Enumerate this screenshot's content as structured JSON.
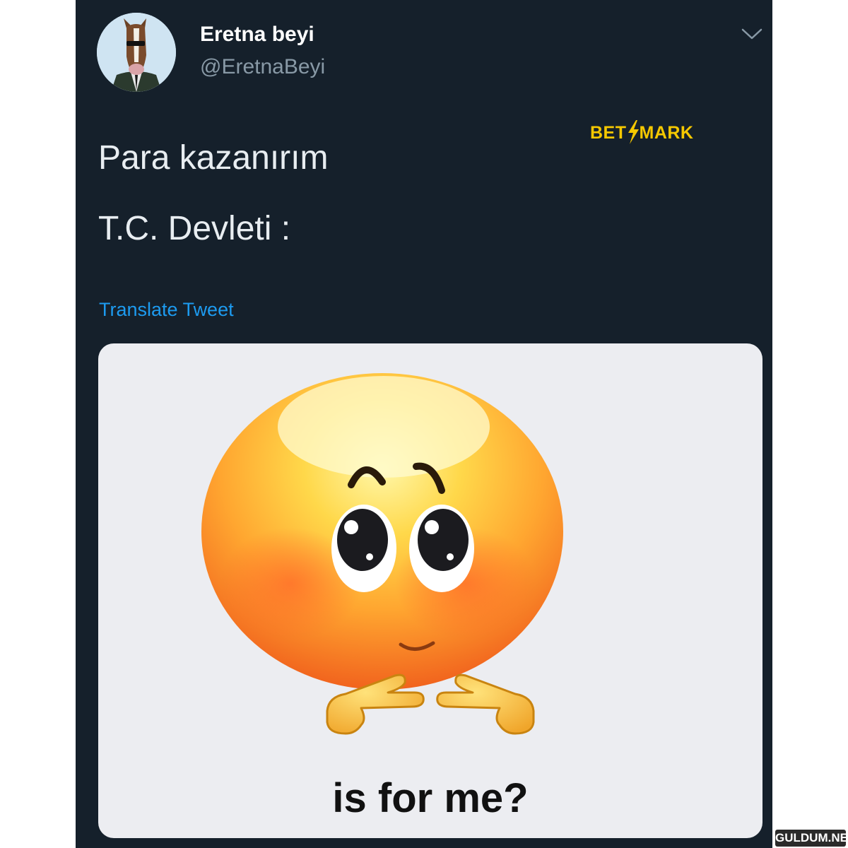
{
  "tweet": {
    "display_name": "Eretna beyi",
    "handle": "@EretnaBeyi",
    "lines": [
      "Para kazanırım",
      "T.C. Devleti :"
    ],
    "translate_label": "Translate Tweet",
    "menu_icon": "chevron-down-icon",
    "avatar_icon": "horse-character-avatar"
  },
  "overlay": {
    "brand_left": "BET",
    "brand_right": "MARK",
    "brand_color": "#f5c800"
  },
  "media": {
    "caption": "is for me?",
    "emoji": "shy-face-pointing-fingers"
  },
  "watermark": {
    "label": "GULDUM.NET"
  },
  "colors": {
    "background": "#15202b",
    "text": "#e8edf1",
    "secondary": "#8899a6",
    "link": "#1d9bf0"
  }
}
